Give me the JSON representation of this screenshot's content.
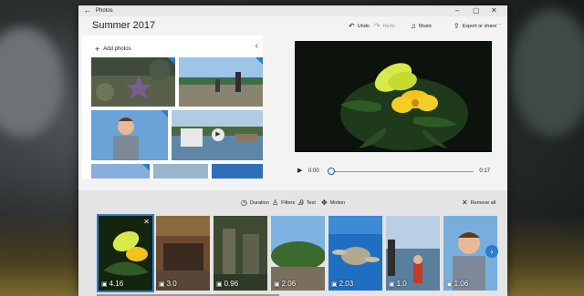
{
  "app": {
    "name": "Photos",
    "project_title": "Summer 2017"
  },
  "toolbar": {
    "undo": "Undo",
    "redo": "Redo",
    "music": "Music",
    "export": "Export or share",
    "more": "···"
  },
  "library": {
    "add_photos": "Add photos"
  },
  "player": {
    "current_time": "0:00",
    "total_time": "0:17",
    "progress": 0.0
  },
  "storyboard": {
    "tools": [
      "Duration",
      "Filters",
      "Text",
      "Motion"
    ],
    "remove_all": "Remove all",
    "cards": [
      {
        "duration": "4.16",
        "selected": true
      },
      {
        "duration": "3.0"
      },
      {
        "duration": "0.96"
      },
      {
        "duration": "2.06"
      },
      {
        "duration": "2.03"
      },
      {
        "duration": "1.0"
      },
      {
        "duration": "1.06"
      }
    ]
  }
}
